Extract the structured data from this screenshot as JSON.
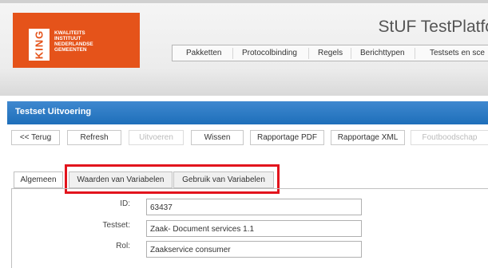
{
  "logo": {
    "abbr": "KING",
    "line1": "KWALITEITS",
    "line2": "INSTITUUT",
    "line3": "NEDERLANDSE",
    "line4": "GEMEENTEN"
  },
  "app_title": "StUF TestPlatfo",
  "nav": [
    "Pakketten",
    "Protocolbinding",
    "Regels",
    "Berichttypen",
    "Testsets en sce"
  ],
  "section_title": "Testset Uitvoering",
  "toolbar": {
    "back": "<< Terug",
    "refresh": "Refresh",
    "execute": "Uitvoeren",
    "clear": "Wissen",
    "report_pdf": "Rapportage PDF",
    "report_xml": "Rapportage XML",
    "error_message": "Foutboodschap"
  },
  "tabs": [
    "Algemeen",
    "Waarden van Variabelen",
    "Gebruik van Variabelen"
  ],
  "form": {
    "id_label": "ID:",
    "id_value": "63437",
    "testset_label": "Testset:",
    "testset_value": "Zaak- Document services 1.1",
    "rol_label": "Rol:",
    "rol_value": "Zaakservice consumer"
  },
  "colors": {
    "brand": "#e5531a",
    "section_bar": "#2a7bc6",
    "highlight": "#e2141d"
  }
}
